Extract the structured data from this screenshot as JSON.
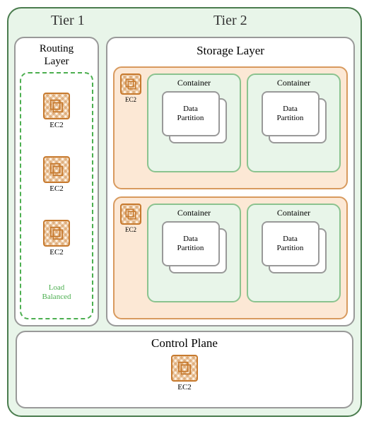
{
  "tiers": {
    "tier1": "Tier 1",
    "tier2": "Tier 2"
  },
  "routing": {
    "title_line1": "Routing",
    "title_line2": "Layer",
    "load_balanced_line1": "Load",
    "load_balanced_line2": "Balanced",
    "instances": [
      {
        "label": "EC2"
      },
      {
        "label": "EC2"
      },
      {
        "label": "EC2"
      }
    ]
  },
  "storage": {
    "title": "Storage Layer",
    "hosts": [
      {
        "ec2_label": "EC2",
        "containers": [
          {
            "title": "Container",
            "partition_line1": "Data",
            "partition_line2": "Partition"
          },
          {
            "title": "Container",
            "partition_line1": "Data",
            "partition_line2": "Partition"
          }
        ]
      },
      {
        "ec2_label": "EC2",
        "containers": [
          {
            "title": "Container",
            "partition_line1": "Data",
            "partition_line2": "Partition"
          },
          {
            "title": "Container",
            "partition_line1": "Data",
            "partition_line2": "Partition"
          }
        ]
      }
    ]
  },
  "control_plane": {
    "title": "Control Plane",
    "ec2_label": "EC2"
  },
  "colors": {
    "outer_bg": "#e8f5e9",
    "outer_border": "#4a7c4e",
    "host_bg": "#fce8d5",
    "host_border": "#d89a5e",
    "container_bg": "#e8f5e9",
    "container_border": "#8bc38f",
    "lb_border": "#4caf50"
  }
}
